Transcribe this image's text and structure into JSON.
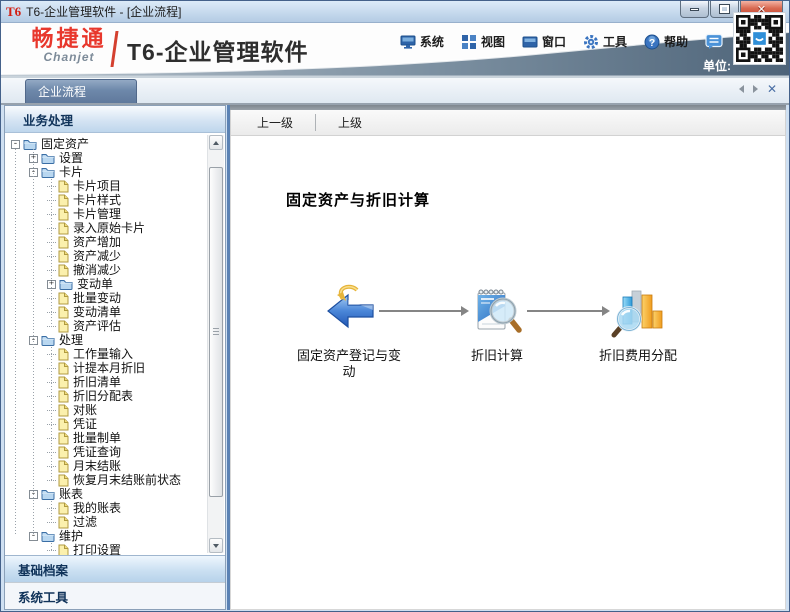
{
  "window": {
    "icon_text": "T6",
    "title": "T6-企业管理软件 - [企业流程]",
    "controls": {
      "minimize": "minimize",
      "maximize": "maximize",
      "close": "close"
    }
  },
  "header": {
    "logo_cn": "畅捷通",
    "logo_en": "Chanjet",
    "product_title": "T6-企业管理软件",
    "menu": [
      {
        "label": "系统",
        "icon": "monitor-icon"
      },
      {
        "label": "视图",
        "icon": "grid-icon"
      },
      {
        "label": "窗口",
        "icon": "window-icon"
      },
      {
        "label": "工具",
        "icon": "gear-icon"
      },
      {
        "label": "帮助",
        "icon": "help-icon"
      }
    ],
    "chat_icon": "chat-icon",
    "unit_label": "单位:"
  },
  "tabs": {
    "active": "企业流程"
  },
  "sidebar": {
    "panels": {
      "top": "业务处理",
      "middle": "基础档案",
      "bottom": "系统工具"
    },
    "tree": [
      {
        "indent": 0,
        "toggle": "minus",
        "icon": "folder",
        "label": "固定资产"
      },
      {
        "indent": 1,
        "toggle": "plus",
        "icon": "folder",
        "label": "设置"
      },
      {
        "indent": 1,
        "toggle": "minus",
        "icon": "folder",
        "label": "卡片"
      },
      {
        "indent": 2,
        "toggle": null,
        "icon": "leaf",
        "label": "卡片项目"
      },
      {
        "indent": 2,
        "toggle": null,
        "icon": "leaf",
        "label": "卡片样式"
      },
      {
        "indent": 2,
        "toggle": null,
        "icon": "leaf",
        "label": "卡片管理"
      },
      {
        "indent": 2,
        "toggle": null,
        "icon": "leaf",
        "label": "录入原始卡片"
      },
      {
        "indent": 2,
        "toggle": null,
        "icon": "leaf",
        "label": "资产增加"
      },
      {
        "indent": 2,
        "toggle": null,
        "icon": "leaf",
        "label": "资产减少"
      },
      {
        "indent": 2,
        "toggle": null,
        "icon": "leaf",
        "label": "撤消减少"
      },
      {
        "indent": 2,
        "toggle": "plus",
        "icon": "folder",
        "label": "变动单"
      },
      {
        "indent": 2,
        "toggle": null,
        "icon": "leaf",
        "label": "批量变动"
      },
      {
        "indent": 2,
        "toggle": null,
        "icon": "leaf",
        "label": "变动清单"
      },
      {
        "indent": 2,
        "toggle": null,
        "icon": "leaf",
        "label": "资产评估"
      },
      {
        "indent": 1,
        "toggle": "minus",
        "icon": "folder",
        "label": "处理"
      },
      {
        "indent": 2,
        "toggle": null,
        "icon": "leaf",
        "label": "工作量输入"
      },
      {
        "indent": 2,
        "toggle": null,
        "icon": "leaf",
        "label": "计提本月折旧"
      },
      {
        "indent": 2,
        "toggle": null,
        "icon": "leaf",
        "label": "折旧清单"
      },
      {
        "indent": 2,
        "toggle": null,
        "icon": "leaf",
        "label": "折旧分配表"
      },
      {
        "indent": 2,
        "toggle": null,
        "icon": "leaf",
        "label": "对账"
      },
      {
        "indent": 2,
        "toggle": null,
        "icon": "leaf",
        "label": "凭证"
      },
      {
        "indent": 2,
        "toggle": null,
        "icon": "leaf",
        "label": "批量制单"
      },
      {
        "indent": 2,
        "toggle": null,
        "icon": "leaf",
        "label": "凭证查询"
      },
      {
        "indent": 2,
        "toggle": null,
        "icon": "leaf",
        "label": "月末结账"
      },
      {
        "indent": 2,
        "toggle": null,
        "icon": "leaf",
        "label": "恢复月末结账前状态"
      },
      {
        "indent": 1,
        "toggle": "minus",
        "icon": "folder",
        "label": "账表"
      },
      {
        "indent": 2,
        "toggle": null,
        "icon": "leaf",
        "label": "我的账表"
      },
      {
        "indent": 2,
        "toggle": null,
        "icon": "leaf",
        "label": "过滤"
      },
      {
        "indent": 1,
        "toggle": "minus",
        "icon": "folder",
        "label": "维护"
      },
      {
        "indent": 2,
        "toggle": null,
        "icon": "leaf",
        "label": "打印设置"
      }
    ]
  },
  "main": {
    "toolbar": {
      "up_one_level": "上一级",
      "up_level": "上级"
    },
    "heading": "固定资产与折旧计算",
    "flow": {
      "steps": [
        {
          "label": "固定资产登记与变动",
          "icon": "back-arrow-icon"
        },
        {
          "label": "折旧计算",
          "icon": "notepad-magnifier-icon"
        },
        {
          "label": "折旧费用分配",
          "icon": "chart-magnifier-icon"
        }
      ]
    }
  },
  "colors": {
    "brand_red": "#e8372c",
    "swoosh_dark": "#51687d",
    "tab_blue": "#6d88aa",
    "splitter_blue": "#5b82b4",
    "folder_blue": "#3a6ea5",
    "leaf_yellow": "#e6c55a",
    "arrow_gray": "#858585"
  }
}
